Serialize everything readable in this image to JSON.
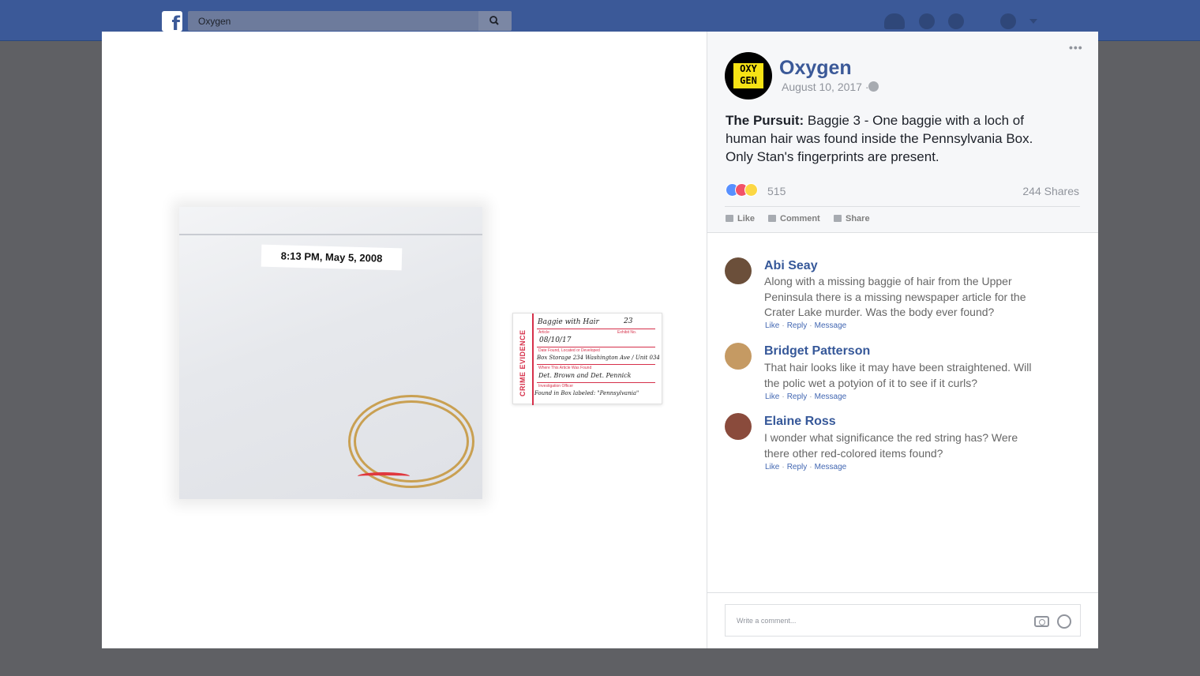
{
  "topbar": {
    "logo_letter": "f",
    "search_value": "Oxygen",
    "icons": [
      "friends-icon",
      "messages-icon",
      "notifications-globe-icon",
      "help-icon",
      "caret-down-icon"
    ],
    "brand_color": "#3b5998"
  },
  "photo": {
    "bag_label": "8:13 PM, May 5, 2008",
    "card": {
      "side_title": "CRIME EVIDENCE",
      "article": "Baggie with Hair",
      "article_caption": "Article",
      "exhibit_no": "23",
      "exhibit_caption": "Exhibit No.",
      "date": "08/10/17",
      "date_caption": "Date Found, Located or Developed",
      "location": "Box Storage 234 Washington Ave / Unit 034",
      "location_caption": "Where This Article Was Found",
      "officer": "Det. Brown and Det. Pennick",
      "officer_caption": "Investigation Officer",
      "note": "Found in Box labeled: \"Pennsylvania\""
    }
  },
  "post": {
    "more_label": "•••",
    "page_name": "Oxygen",
    "logo_text_top": "OXY",
    "logo_text_bottom": "GEN",
    "date": "August 10, 2017 ·",
    "text_bold": "The Pursuit:",
    "text_body": " Baggie 3 - One baggie with a loch of human hair was found inside the Pennsylvania Box. Only Stan's fingerprints are present.",
    "reaction_count": "515",
    "shares": "244 Shares",
    "actions": {
      "like": "Like",
      "comment": "Comment",
      "share": "Share"
    }
  },
  "comments": [
    {
      "name": "Abi Seay",
      "text": "Along with a missing baggie of hair from the Upper Peninsula there is a missing newspaper article for the Crater Lake murder. Was the body ever found?",
      "like": "Like",
      "reply": "Reply",
      "message": "Message",
      "avatar_color": "#6b4f3a"
    },
    {
      "name": "Bridget Patterson",
      "text": "That hair looks like it may have been straightened. Will the polic wet a potyion of it to see if it curls?",
      "like": "Like",
      "reply": "Reply",
      "message": "Message",
      "avatar_color": "#c59a63"
    },
    {
      "name": "Elaine Ross",
      "text": "I wonder what significance the red string has? Were there other red-colored items found?",
      "like": "Like",
      "reply": "Reply",
      "message": "Message",
      "avatar_color": "#8a4b3c"
    }
  ],
  "composer": {
    "placeholder": "Write a comment...",
    "icons": [
      "camera-icon",
      "emoji-icon"
    ]
  }
}
